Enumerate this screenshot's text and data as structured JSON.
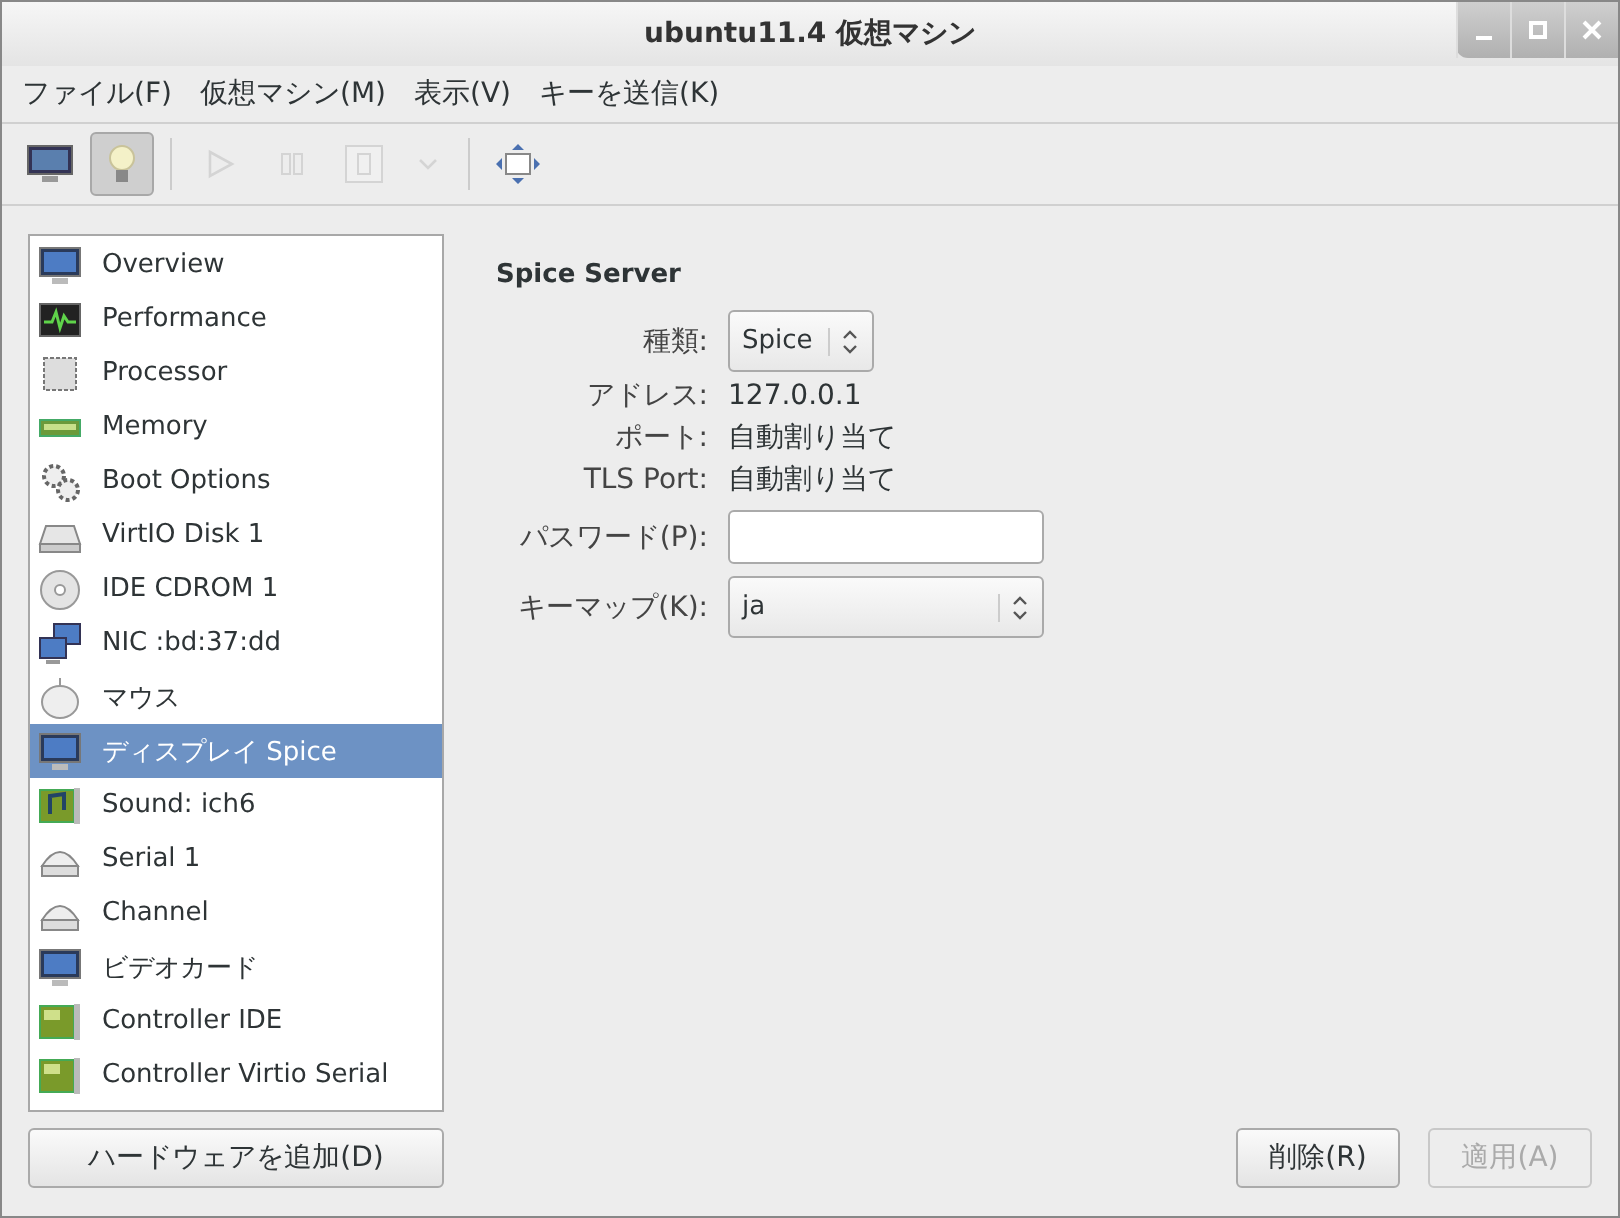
{
  "window": {
    "title": "ubuntu11.4 仮想マシン"
  },
  "menu": [
    "ファイル(F)",
    "仮想マシン(M)",
    "表示(V)",
    "キーを送信(K)"
  ],
  "toolbar": [
    {
      "kind": "console",
      "selected": false,
      "disabled": false
    },
    {
      "kind": "details",
      "selected": true,
      "disabled": false
    },
    {
      "kind": "run",
      "selected": false,
      "disabled": true
    },
    {
      "kind": "pause",
      "selected": false,
      "disabled": true
    },
    {
      "kind": "shutdown",
      "selected": false,
      "disabled": true
    },
    {
      "kind": "dropdown",
      "selected": false,
      "disabled": true
    },
    {
      "kind": "fullscreen",
      "selected": false,
      "disabled": false
    }
  ],
  "sidebar": {
    "items": [
      {
        "label": "Overview",
        "kind": "monitor",
        "selected": false
      },
      {
        "label": "Performance",
        "kind": "perf",
        "selected": false
      },
      {
        "label": "Processor",
        "kind": "chip",
        "selected": false
      },
      {
        "label": "Memory",
        "kind": "memory",
        "selected": false
      },
      {
        "label": "Boot Options",
        "kind": "gears",
        "selected": false
      },
      {
        "label": "VirtIO Disk 1",
        "kind": "disk",
        "selected": false
      },
      {
        "label": "IDE CDROM 1",
        "kind": "cdrom",
        "selected": false
      },
      {
        "label": "NIC :bd:37:dd",
        "kind": "nic",
        "selected": false
      },
      {
        "label": "マウス",
        "kind": "mouse",
        "selected": false
      },
      {
        "label": "ディスプレイ Spice",
        "kind": "monitor",
        "selected": true
      },
      {
        "label": "Sound: ich6",
        "kind": "sound",
        "selected": false
      },
      {
        "label": "Serial 1",
        "kind": "serial",
        "selected": false
      },
      {
        "label": "Channel",
        "kind": "serial",
        "selected": false
      },
      {
        "label": "ビデオカード",
        "kind": "monitor",
        "selected": false
      },
      {
        "label": "Controller IDE",
        "kind": "card",
        "selected": false
      },
      {
        "label": "Controller Virtio Serial",
        "kind": "card",
        "selected": false
      }
    ],
    "add_button": "ハードウェアを追加(D)"
  },
  "panel": {
    "heading": "Spice Server",
    "fields": [
      {
        "label": "種類:",
        "kind": "combo",
        "value": "Spice"
      },
      {
        "label": "アドレス:",
        "kind": "text",
        "value": "127.0.0.1"
      },
      {
        "label": "ポート:",
        "kind": "text",
        "value": "自動割り当て"
      },
      {
        "label": "TLS Port:",
        "kind": "text",
        "value": "自動割り当て"
      },
      {
        "label": "パスワード(P):",
        "kind": "entry"
      },
      {
        "label": "キーマップ(K):",
        "kind": "wide_combo",
        "value": "ja"
      }
    ]
  },
  "buttons": [
    {
      "label": "削除(R)",
      "disabled": false
    },
    {
      "label": "適用(A)",
      "disabled": true
    }
  ]
}
